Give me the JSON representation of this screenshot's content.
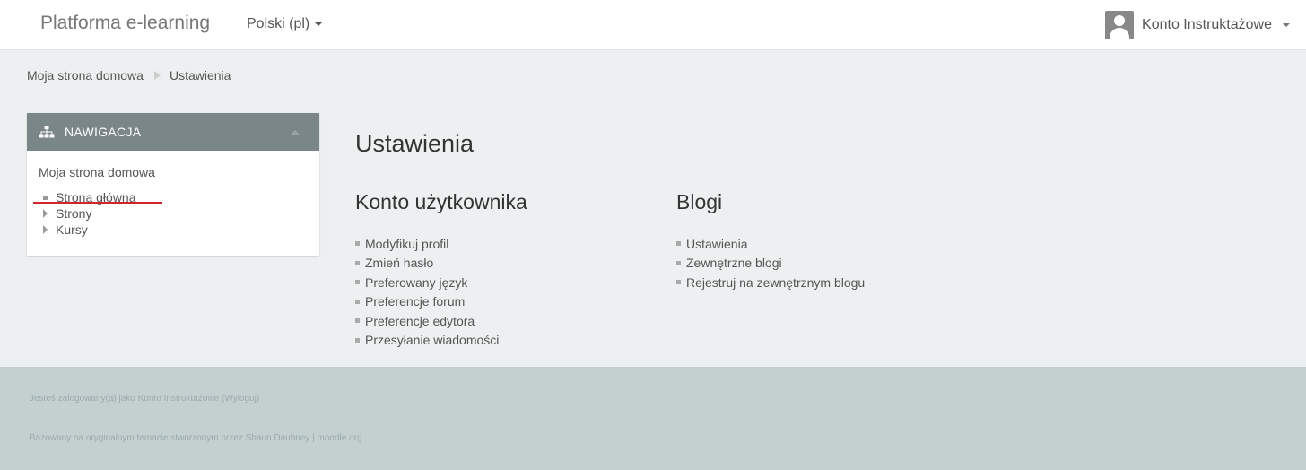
{
  "navbar": {
    "brand": "Platforma e-learning",
    "language": "Polski (pl)",
    "user_name": "Konto Instruktażowe"
  },
  "breadcrumb": {
    "home": "Moja strona domowa",
    "current": "Ustawienia"
  },
  "navigation_block": {
    "title": "NAWIGACJA",
    "root": "Moja strona domowa",
    "items": [
      {
        "label": "Strona główna",
        "type": "leaf"
      },
      {
        "label": "Strony",
        "type": "expandable"
      },
      {
        "label": "Kursy",
        "type": "expandable"
      }
    ]
  },
  "main": {
    "title": "Ustawienia",
    "account": {
      "heading": "Konto użytkownika",
      "links": [
        "Modyfikuj profil",
        "Zmień hasło",
        "Preferowany język",
        "Preferencje forum",
        "Preferencje edytora",
        "Przesyłanie wiadomości"
      ]
    },
    "blogs": {
      "heading": "Blogi",
      "links": [
        "Ustawienia",
        "Zewnętrzne blogi",
        "Rejestruj na zewnętrznym blogu"
      ]
    }
  },
  "footer": {
    "login_prefix": "Jesteś zalogowany(a) jako ",
    "login_user": "Konto Instruktażowe",
    "logout": "(Wyloguj)",
    "theme_credit": "Bazowany na oryginalnym temacie stworzonym przez Shaun Daubney | moodle.org"
  },
  "colors": {
    "block_header": "#7a8688",
    "footer_bg": "#c4d0d0",
    "highlight_underline": "#d0252a"
  }
}
